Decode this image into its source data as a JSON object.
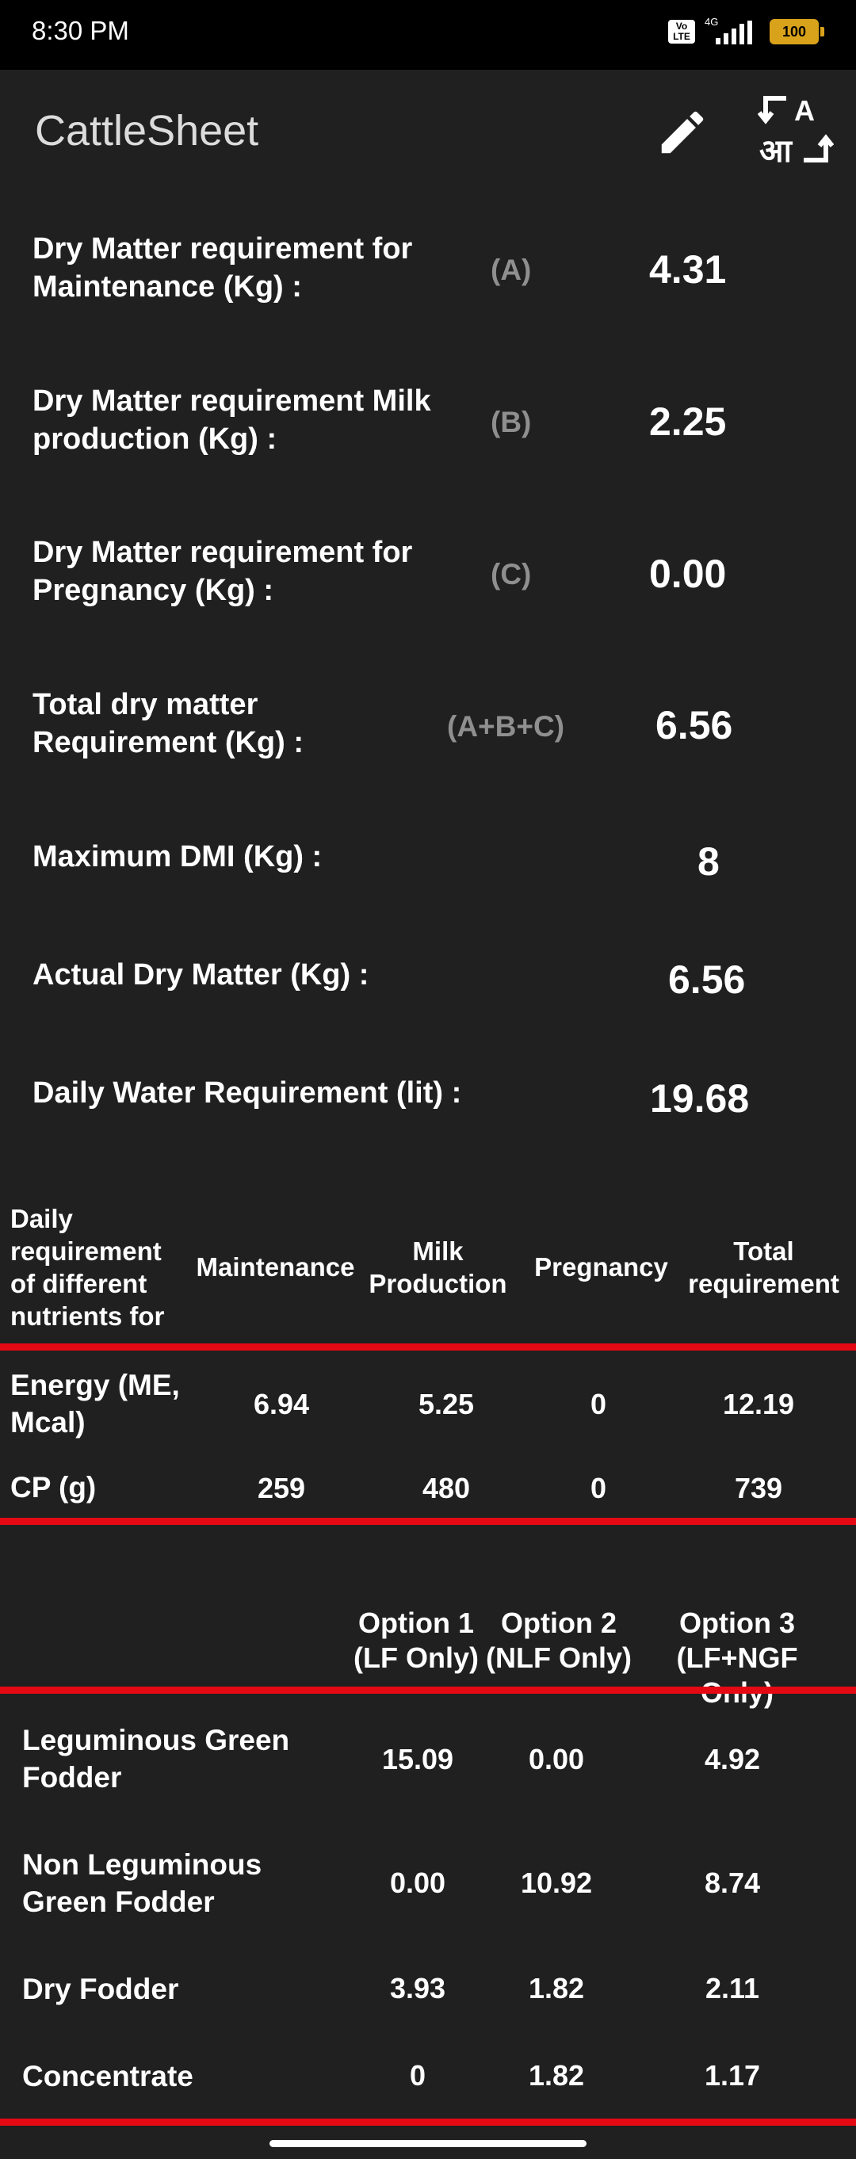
{
  "status_bar": {
    "time": "8:30 PM",
    "network": "4G",
    "volte": "Vo LTE",
    "battery": "100"
  },
  "app": {
    "title": "CattleSheet",
    "edit_icon": "pencil-icon",
    "translate_icon": "translate-icon"
  },
  "requirements": [
    {
      "label_line1": "Dry Matter requirement for",
      "label_line2": "Maintenance (Kg) :",
      "tag": "(A)",
      "value": "4.31"
    },
    {
      "label_line1": "Dry Matter requirement Milk",
      "label_line2": "production (Kg) :",
      "tag": "(B)",
      "value": "2.25"
    },
    {
      "label_line1": "Dry Matter requirement for",
      "label_line2": "Pregnancy (Kg) :",
      "tag": "(C)",
      "value": "0.00"
    },
    {
      "label_line1": "Total dry matter",
      "label_line2": "Requirement (Kg) :",
      "tag": "(A+B+C)",
      "value": "6.56"
    },
    {
      "label": "Maximum DMI (Kg) :",
      "value": "8"
    },
    {
      "label": "Actual Dry Matter (Kg) :",
      "value": "6.56"
    },
    {
      "label": "Daily Water Requirement (lit) :",
      "value": "19.68"
    }
  ],
  "nutrients_table": {
    "header": {
      "rowhead": [
        "Daily",
        "requirement",
        "of different",
        "nutrients for"
      ],
      "maintenance": "Maintenance",
      "milk": [
        "Milk",
        "Production"
      ],
      "pregnancy": "Pregnancy",
      "total": [
        "Total",
        "requirement"
      ]
    },
    "rows": [
      {
        "name_line1": "Energy (ME,",
        "name_line2": "Mcal)",
        "values": [
          "6.94",
          "5.25",
          "0",
          "12.19"
        ]
      },
      {
        "name": "CP (g)",
        "values": [
          "259",
          "480",
          "0",
          "739"
        ]
      }
    ]
  },
  "feed_table": {
    "header": [
      {
        "line1": "Option 1",
        "line2": "(LF Only)"
      },
      {
        "line1": "Option 2",
        "line2": "(NLF Only)"
      },
      {
        "line1": "Option 3",
        "line2": "(LF+NGF Only)"
      }
    ],
    "rows": [
      {
        "name_line1": "Leguminous Green",
        "name_line2": "Fodder",
        "values": [
          "15.09",
          "0.00",
          "4.92"
        ]
      },
      {
        "name_line1": "Non Leguminous",
        "name_line2": "Green Fodder",
        "values": [
          "0.00",
          "10.92",
          "8.74"
        ]
      },
      {
        "name": "Dry Fodder",
        "values": [
          "3.93",
          "1.82",
          "2.11"
        ]
      },
      {
        "name": "Concentrate",
        "values": [
          "0",
          "1.82",
          "1.17"
        ]
      }
    ]
  },
  "colors": {
    "background": "#202020",
    "divider": "#e50914",
    "tag": "#8f8f8f",
    "battery": "#d9a21b"
  }
}
